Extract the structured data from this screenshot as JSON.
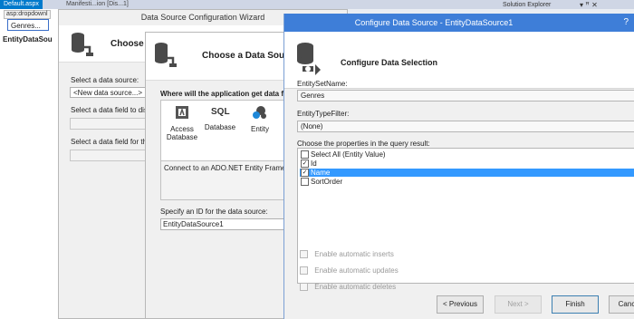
{
  "ide": {
    "active_tab": "Default.aspx",
    "second_tab": "Manifesti...ion [Dis...1]",
    "tag_label": "asp:dropdownl",
    "genres_value": "Genres...",
    "eds_label": "EntityDataSou",
    "solution_explorer_title": "Solution Explorer",
    "window_controls": "▾ ꟸ ✕"
  },
  "wizard": {
    "title": "Data Source Configuration Wizard",
    "header": "Choose a",
    "select_ds_label": "Select a data source:",
    "select_ds_value": "<New data source...>",
    "select_display_label": "Select a data field to displ",
    "select_value_label": "Select a data field for the v"
  },
  "choose_ds": {
    "header": "Choose a Data Source T",
    "where_label": "Where will the application get data from",
    "items": [
      {
        "label": "Access Database",
        "icon": "access-database-icon"
      },
      {
        "label": "Database",
        "icon": "sql-database-icon"
      },
      {
        "label": "Entity",
        "icon": "entity-icon"
      }
    ],
    "sql_text": "SQL",
    "description": "Connect to an ADO.NET Entity Framework",
    "id_label": "Specify an ID for the data source:",
    "id_value": "EntityDataSource1"
  },
  "configure": {
    "title": "Configure Data Source - EntityDataSource1",
    "help": "?",
    "header": "Configure Data Selection",
    "entityset_label": "EntitySetName:",
    "entityset_value": "Genres",
    "typefilter_label": "EntityTypeFilter:",
    "typefilter_value": "(None)",
    "props_label": "Choose the properties in the query result:",
    "properties": [
      {
        "label": "Select All (Entity Value)",
        "checked": false,
        "selected": false
      },
      {
        "label": "Id",
        "checked": true,
        "selected": false
      },
      {
        "label": "Name",
        "checked": true,
        "selected": true
      },
      {
        "label": "SortOrder",
        "checked": false,
        "selected": false
      }
    ],
    "auto_inserts": "Enable automatic inserts",
    "auto_updates": "Enable automatic updates",
    "auto_deletes": "Enable automatic deletes",
    "buttons": {
      "previous": "< Previous",
      "next": "Next >",
      "finish": "Finish",
      "cancel": "Canc"
    }
  },
  "colors": {
    "title_bar": "#3e7ed8",
    "selection": "#3399ff",
    "vs_tab": "#007acc"
  }
}
